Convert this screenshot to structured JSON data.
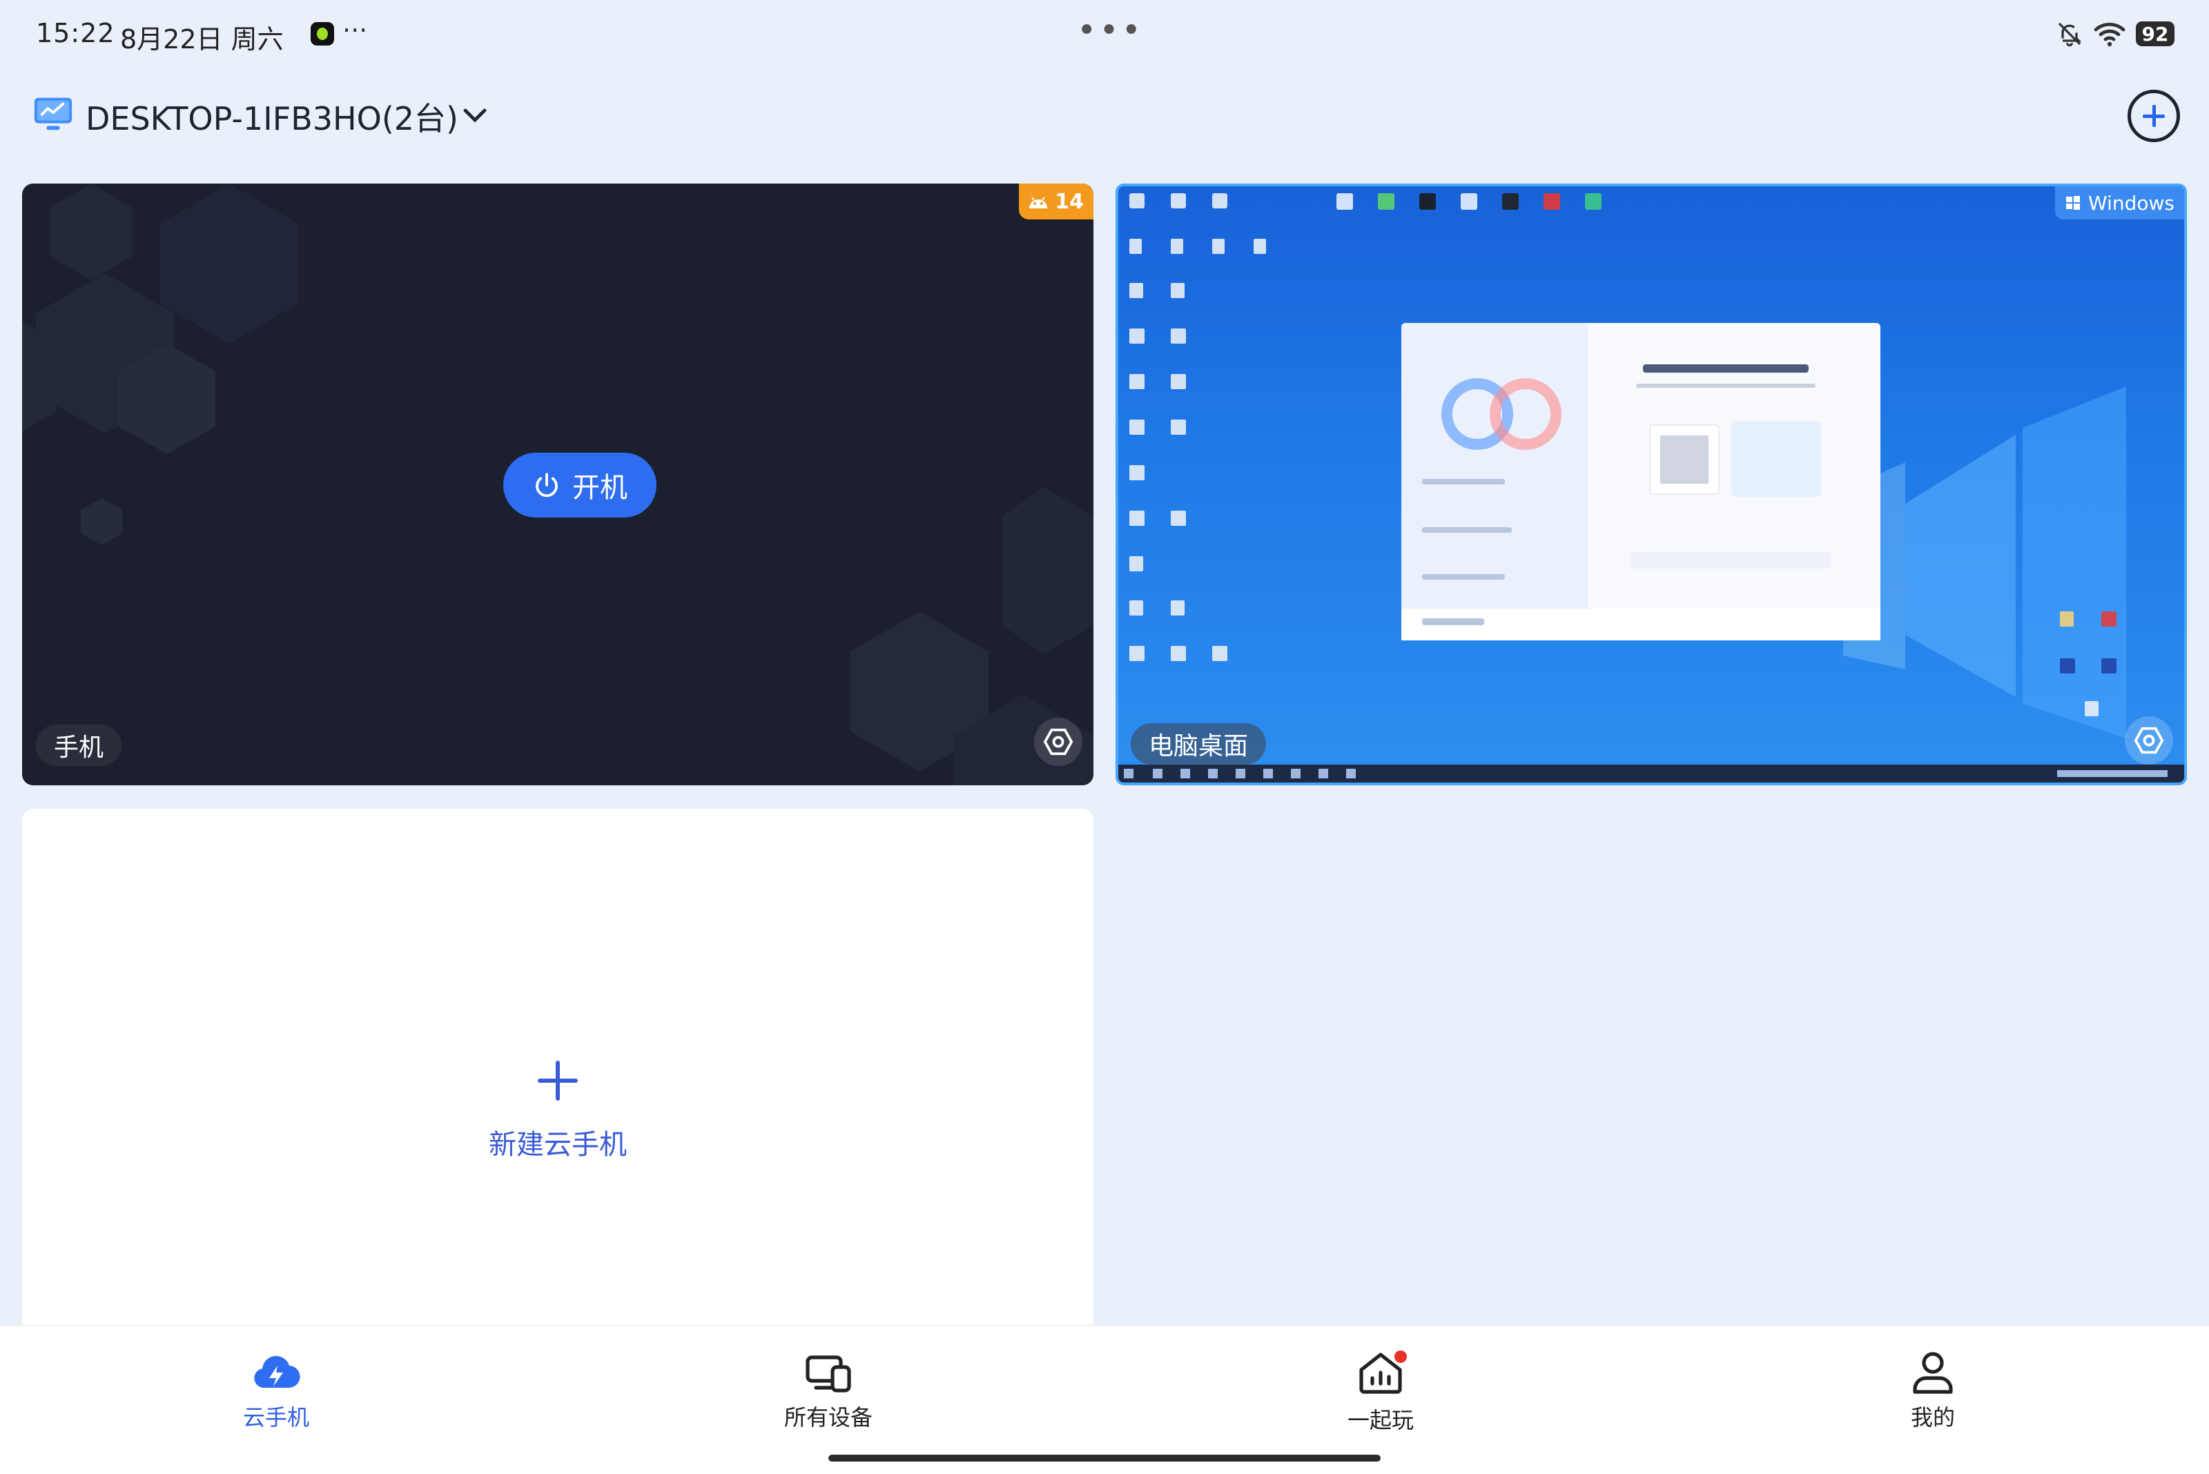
{
  "status_bar": {
    "time": "15:22",
    "date": "8月22日 周六",
    "more": "···",
    "center_dots": "•••",
    "battery": "92"
  },
  "header": {
    "device_name": "DESKTOP-1IFB3HO(2台)"
  },
  "cards": {
    "phone": {
      "badge": "14",
      "power_label": "开机",
      "chip_label": "手机"
    },
    "desktop": {
      "badge": "Windows",
      "chip_label": "电脑桌面"
    },
    "new_phone": {
      "label": "新建云手机"
    }
  },
  "bottom_nav": {
    "items": [
      {
        "label": "云手机",
        "icon": "cloud-lightning-icon",
        "active": true
      },
      {
        "label": "所有设备",
        "icon": "devices-icon",
        "active": false
      },
      {
        "label": "一起玩",
        "icon": "house-chart-icon",
        "active": false,
        "badge_dot": true
      },
      {
        "label": "我的",
        "icon": "person-icon",
        "active": false
      }
    ]
  },
  "colors": {
    "accent": "#2f6df0",
    "active_nav": "#2f5fe0",
    "android_badge": "#f39a1f",
    "windows_badge": "#3a8af1",
    "phone_card_bg": "#1b1f2e",
    "page_bg": "#e9f0fa"
  }
}
